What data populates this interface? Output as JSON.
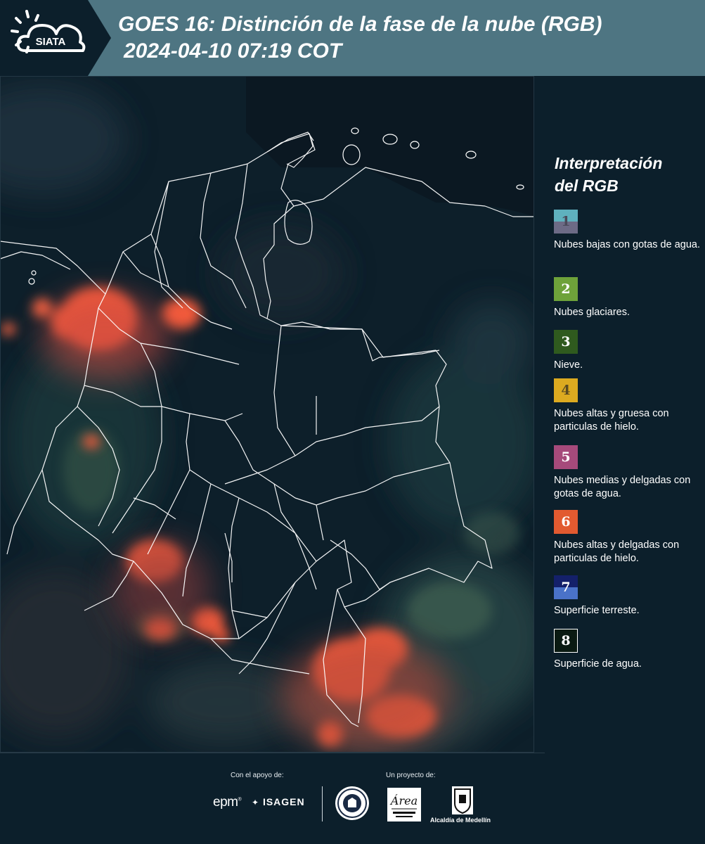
{
  "header": {
    "logo_text": "SIATA",
    "title_line1": "GOES 16: Distinción de la fase de la nube (RGB)",
    "title_line2": "2024-04-10 07:19 COT"
  },
  "legend": {
    "title_line1": "Interpretación",
    "title_line2": "del RGB",
    "items": [
      {
        "number": "1",
        "label": "Nubes bajas con gotas de agua.",
        "color_top": "#5fb1be",
        "color_bottom": "#6d6b86",
        "text_color": "#4a4a5a"
      },
      {
        "number": "2",
        "label": "Nubes glaciares.",
        "color": "#6ea23a",
        "text_color": "#ffffff"
      },
      {
        "number": "3",
        "label": "Nieve.",
        "color": "#2f5a1e",
        "text_color": "#ffffff"
      },
      {
        "number": "4",
        "label": "Nubes altas y gruesa con particulas de hielo.",
        "color": "#dcaa20",
        "text_color": "#5a4a20"
      },
      {
        "number": "5",
        "label": "Nubes medias y delgadas con gotas de agua.",
        "color": "#a64a7b",
        "text_color": "#ffffff"
      },
      {
        "number": "6",
        "label": "Nubes altas y delgadas con particulas de hielo.",
        "color": "#e25a30",
        "text_color": "#ffffff"
      },
      {
        "number": "7",
        "label": "Superficie terreste.",
        "color_top": "#14206a",
        "color_bottom": "#4a72c8",
        "text_color": "#ffffff"
      },
      {
        "number": "8",
        "label": "Superficie de agua.",
        "color": "#0a1a12",
        "text_color": "#ffffff",
        "border": "#ffffff"
      }
    ]
  },
  "footer": {
    "support_label": "Con el apoyo de:",
    "project_label": "Un proyecto de:",
    "epm": "epm",
    "isagen": "ISAGEN",
    "alcaldia": "Alcaldía de Medellín"
  }
}
